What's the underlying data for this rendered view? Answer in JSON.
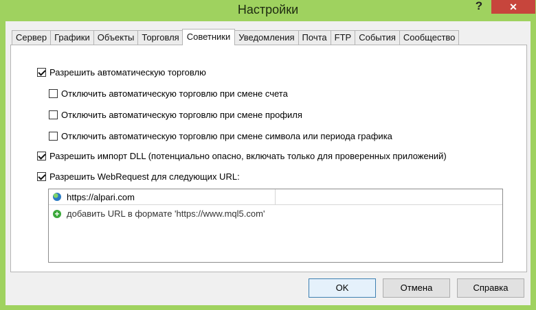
{
  "window": {
    "title": "Настройки",
    "help_label": "?",
    "close_label": "✕"
  },
  "tabs": [
    {
      "label": "Сервер",
      "active": false
    },
    {
      "label": "Графики",
      "active": false
    },
    {
      "label": "Объекты",
      "active": false
    },
    {
      "label": "Торговля",
      "active": false
    },
    {
      "label": "Советники",
      "active": true
    },
    {
      "label": "Уведомления",
      "active": false
    },
    {
      "label": "Почта",
      "active": false
    },
    {
      "label": "FTP",
      "active": false
    },
    {
      "label": "События",
      "active": false
    },
    {
      "label": "Сообщество",
      "active": false
    }
  ],
  "options": {
    "auto_trading": {
      "label": "Разрешить автоматическую торговлю",
      "checked": true
    },
    "disable_on_account": {
      "label": "Отключить автоматическую торговлю при смене счета",
      "checked": false
    },
    "disable_on_profile": {
      "label": "Отключить автоматическую торговлю при смене профиля",
      "checked": false
    },
    "disable_on_symbol": {
      "label": "Отключить автоматическую торговлю при смене символа или периода графика",
      "checked": false
    },
    "dll_import": {
      "label": "Разрешить импорт DLL (потенциально опасно, включать только для проверенных приложений)",
      "checked": true
    },
    "webrequest": {
      "label": "Разрешить WebRequest для следующих URL:",
      "checked": true
    }
  },
  "url_list": {
    "urls": [
      "https://alpari.com"
    ],
    "add_hint": "добавить URL в формате 'https://www.mql5.com'"
  },
  "buttons": {
    "ok": "OK",
    "cancel": "Отмена",
    "help": "Справка"
  }
}
